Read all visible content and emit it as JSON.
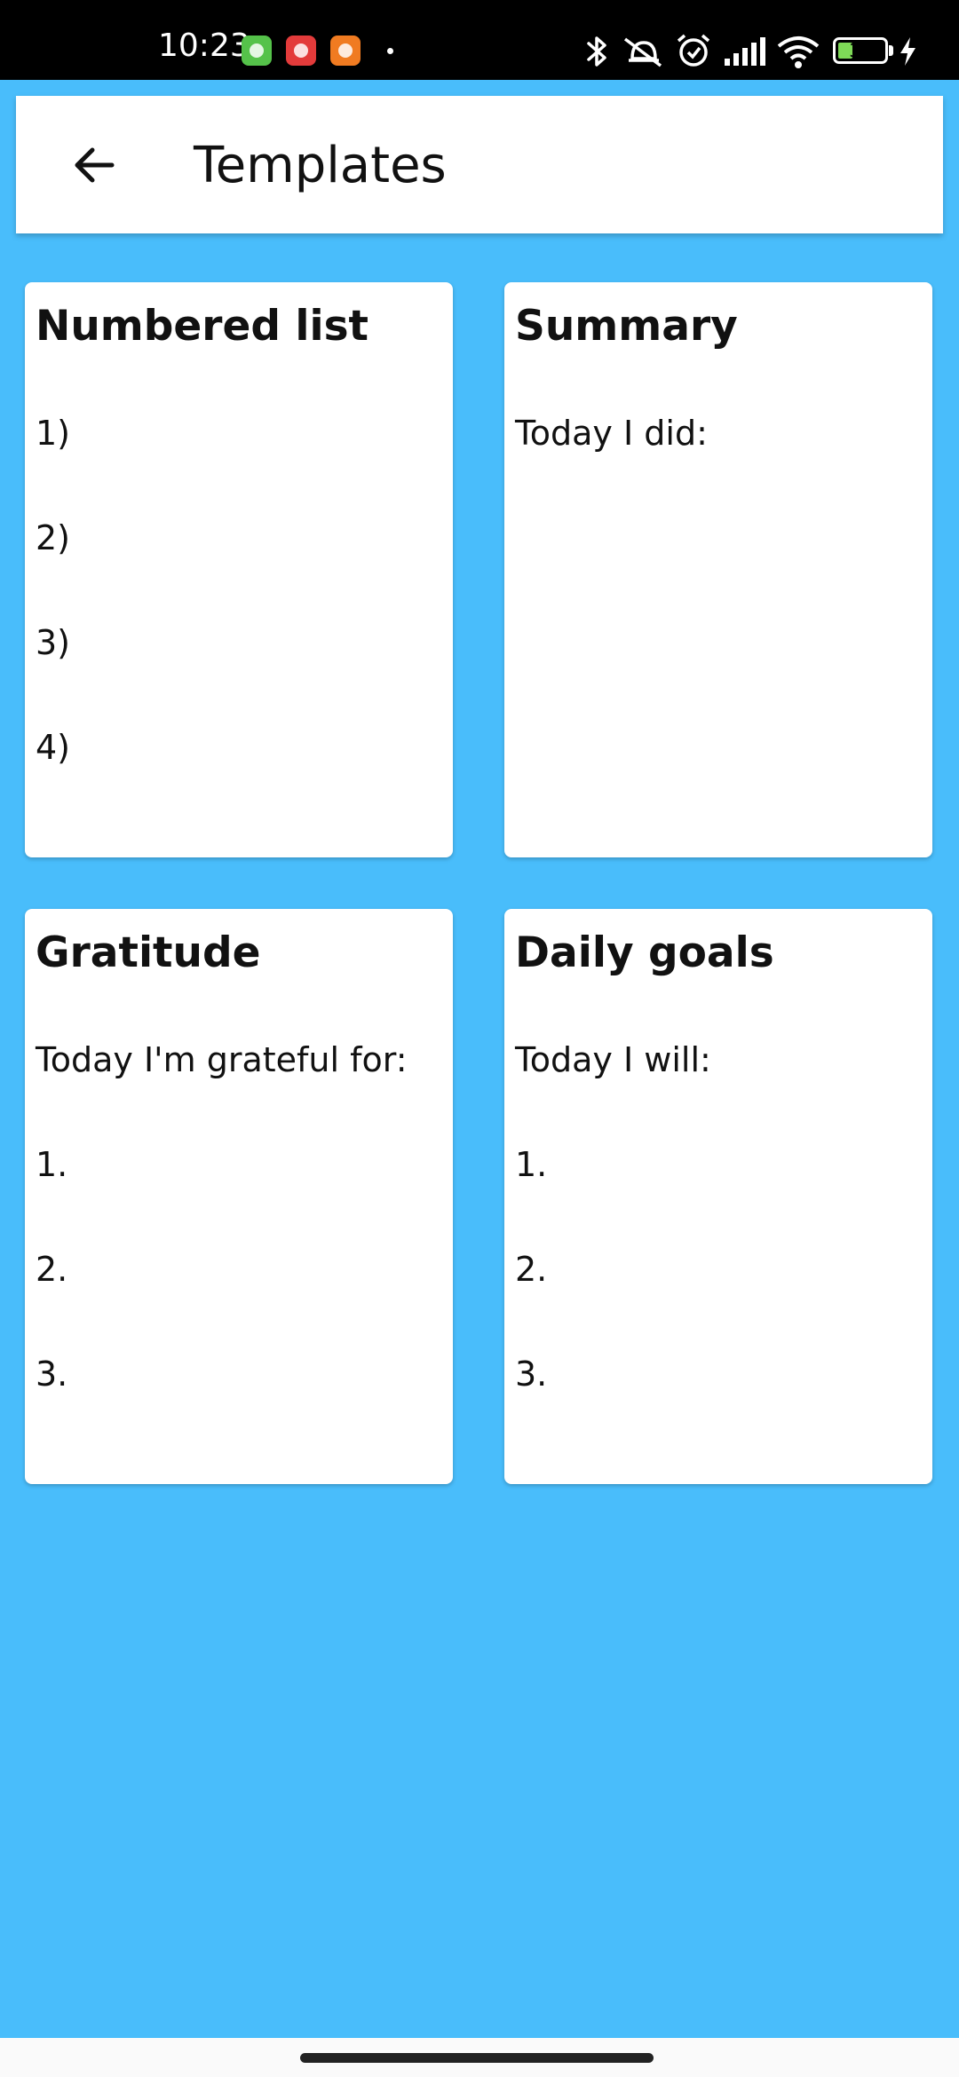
{
  "status_bar": {
    "time": "10:23",
    "battery_level": "32",
    "battery_percent": 32,
    "icons": [
      "app-green-icon",
      "app-red-icon",
      "app-orange-icon",
      "dot-icon",
      "bluetooth-icon",
      "silent-icon",
      "alarm-icon",
      "signal-icon",
      "wifi-icon",
      "battery-icon",
      "charging-icon"
    ]
  },
  "header": {
    "title": "Templates",
    "back_icon": "arrow-left-icon"
  },
  "templates": [
    {
      "title": "Numbered list",
      "lines": [
        "1)",
        "2)",
        "3)",
        "4)"
      ]
    },
    {
      "title": "Summary",
      "lines": [
        "Today I did:"
      ]
    },
    {
      "title": "Gratitude",
      "lines": [
        "Today I'm grateful for:",
        "1.",
        "2.",
        "3."
      ]
    },
    {
      "title": "Daily goals",
      "lines": [
        "Today I will:",
        "1.",
        "2.",
        "3."
      ]
    }
  ],
  "colors": {
    "background": "#49bdfb",
    "card": "#ffffff",
    "status_bar": "#000000",
    "battery_fill": "#7ed957"
  }
}
